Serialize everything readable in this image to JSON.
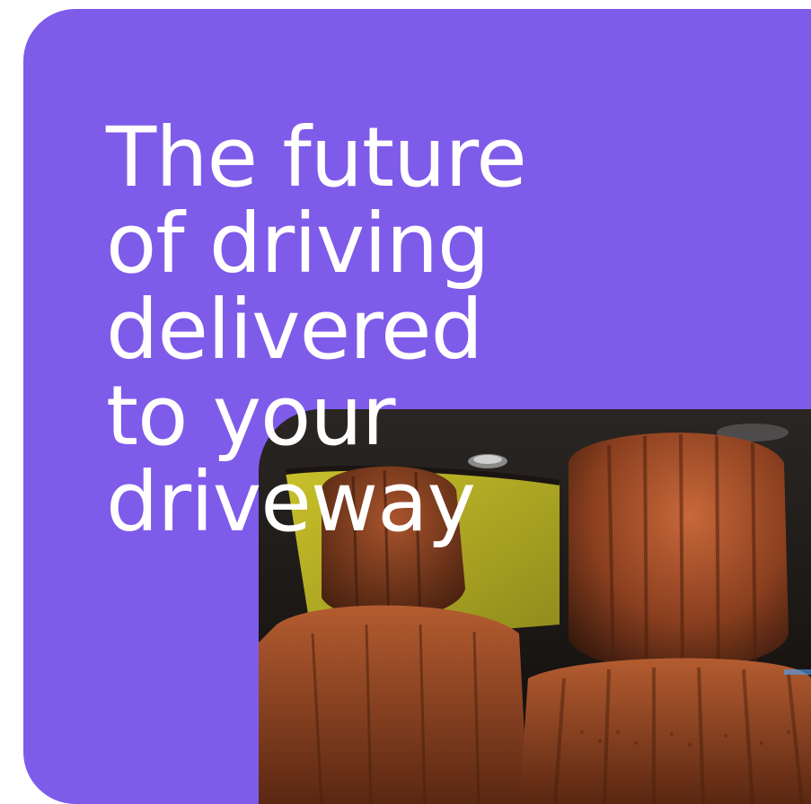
{
  "hero": {
    "headline_lines": [
      "The future",
      "of driving",
      "delivered",
      "to your",
      "driveway"
    ],
    "background_color": "#7f5bea",
    "text_color": "#ffffff"
  },
  "photo": {
    "subject": "car-interior-leather-seats-icon"
  }
}
